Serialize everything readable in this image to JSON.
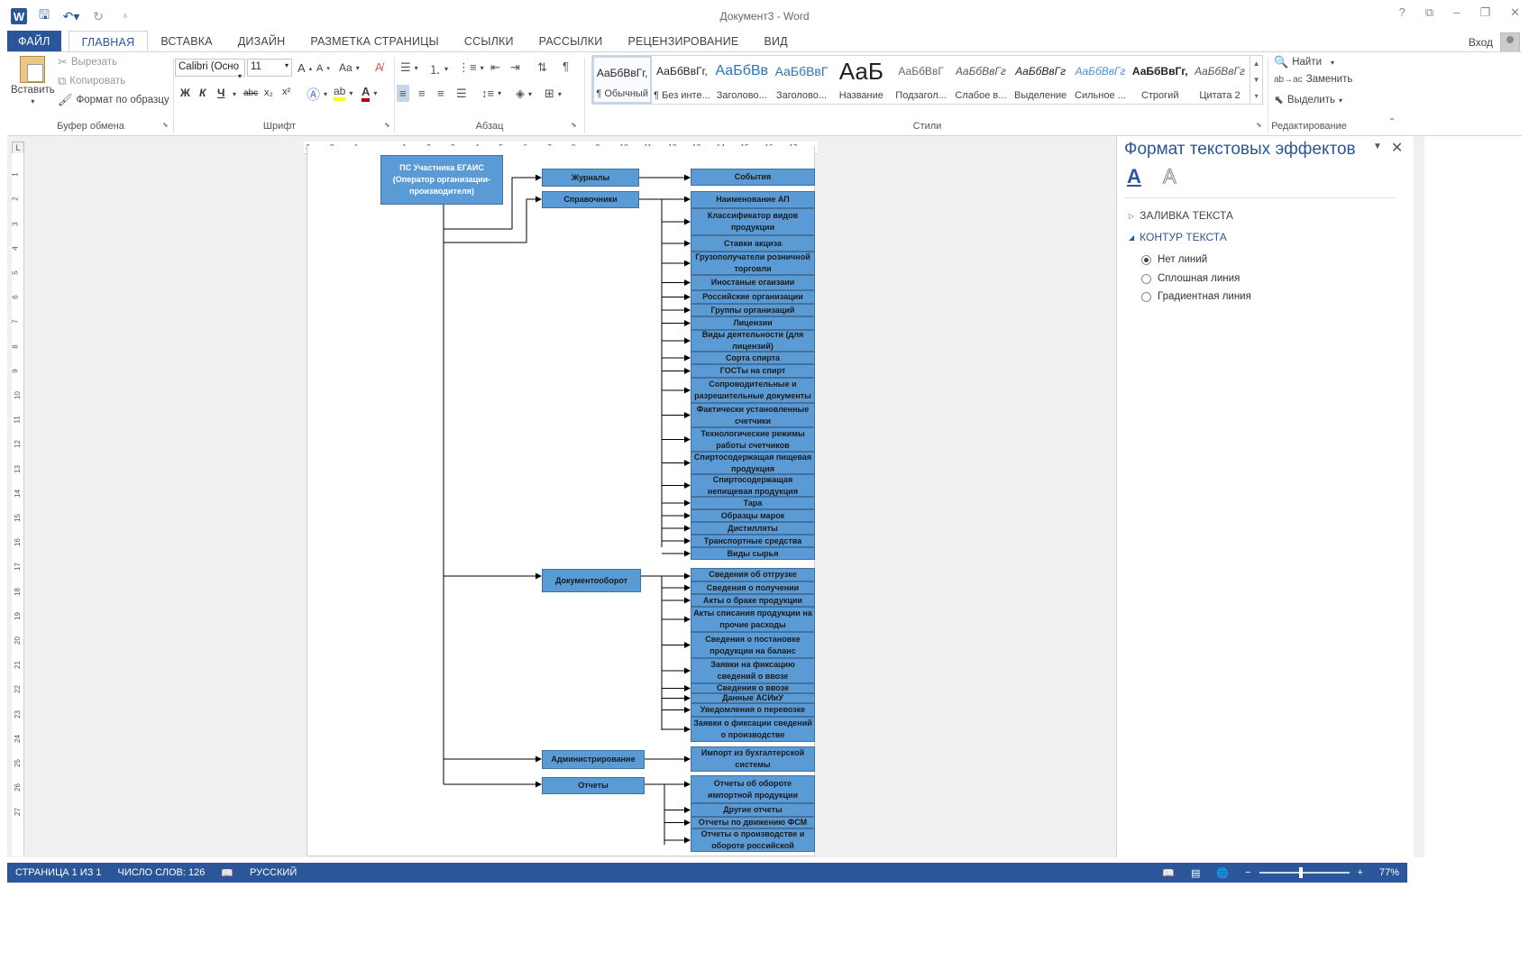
{
  "window": {
    "title": "Документ3 - Word",
    "signin": "Вход",
    "help": "?",
    "minimize": "–",
    "restore": "❐",
    "close": "✕"
  },
  "tabs": [
    "ФАЙЛ",
    "ГЛАВНАЯ",
    "ВСТАВКА",
    "ДИЗАЙН",
    "РАЗМЕТКА СТРАНИЦЫ",
    "ССЫЛКИ",
    "РАССЫЛКИ",
    "РЕЦЕНЗИРОВАНИЕ",
    "ВИД"
  ],
  "clipboard": {
    "paste": "Вставить",
    "cut": "Вырезать",
    "copy": "Копировать",
    "format_painter": "Формат по образцу",
    "label": "Буфер обмена"
  },
  "font": {
    "name": "Calibri (Осно",
    "size": "11",
    "label": "Шрифт",
    "bold": "Ж",
    "italic": "К",
    "underline": "Ч",
    "strike": "abc",
    "sub": "x₂",
    "sup": "x²",
    "grow": "A",
    "shrink": "A",
    "case": "Aa"
  },
  "paragraph": {
    "label": "Абзац"
  },
  "styles": {
    "label": "Стили",
    "items": [
      {
        "preview": "АаБбВвГг,",
        "name": "¶ Обычный"
      },
      {
        "preview": "АаБбВвГг,",
        "name": "¶ Без инте..."
      },
      {
        "preview": "АаБбВв",
        "name": "Заголово..."
      },
      {
        "preview": "АаБбВвГ",
        "name": "Заголово..."
      },
      {
        "preview": "АаБ",
        "name": "Название"
      },
      {
        "preview": "АаБбВвГ",
        "name": "Подзагол..."
      },
      {
        "preview": "АаБбВвГг",
        "name": "Слабое в..."
      },
      {
        "preview": "АаБбВвГг",
        "name": "Выделение"
      },
      {
        "preview": "АаБбВвГг",
        "name": "Сильное ..."
      },
      {
        "preview": "АаБбВвГг,",
        "name": "Строгий"
      },
      {
        "preview": "АаБбВвГг",
        "name": "Цитата 2"
      }
    ]
  },
  "editing": {
    "find": "Найти",
    "replace": "Заменить",
    "select": "Выделить",
    "label": "Редактирование"
  },
  "diagram": {
    "root": "ПС Участника ЕГАИС (Оператор организации-производителя)",
    "journals": "Журналы",
    "events": "События",
    "refs": "Справочники",
    "ref_items": [
      "Наименование АП",
      "Классификатор видов продукции",
      "Ставки акциза",
      "Грузополучатели розничной торговли",
      "Иностаные огаизаии",
      "Российские организации",
      "Группы организаций",
      "Лицензии",
      "Виды деятельности (для лицензий)",
      "Сорта спирта",
      "ГОСТы на спирт",
      "Сопроводительные и разрешительные документы",
      "Фактически установленные счетчики",
      "Технологические режимы работы счетчиков",
      "Спиртосодержащая пищевая продукция",
      "Спиртосодержащая непищевая продукция",
      "Тара",
      "Образцы марок",
      "Дистилляты",
      "Транспортные средства",
      "Виды сырья"
    ],
    "docs": "Документооборот",
    "doc_items": [
      "Сведения об отгрузке",
      "Сведения о получении",
      "Акты о браке продукции",
      "Акты списания продукции на прочие расходы",
      "Сведения о постановке продукции на баланс",
      "Заявки на фиксацию сведений о ввозе",
      "Сведения о ввозе",
      "Данные АСИиУ",
      "Уведомления о перевозке",
      "Заявки о фиксации сведений о производстве"
    ],
    "admin": "Администрирование",
    "admin_item": "Импорт из бухгалтерской системы",
    "reports": "Отчеты",
    "report_items": [
      "Отчеты об обороте импортной продукции",
      "Другие отчеты",
      "Отчеты по движению ФСМ",
      "Отчеты о производстве и обороте российской"
    ]
  },
  "pane": {
    "title": "Формат текстовых эффектов",
    "fill": "ЗАЛИВКА ТЕКСТА",
    "outline": "КОНТУР ТЕКСТА",
    "options": [
      "Нет линий",
      "Сплошная линия",
      "Градиентная линия"
    ]
  },
  "status": {
    "page": "СТРАНИЦА 1 ИЗ 1",
    "words": "ЧИСЛО СЛОВ: 126",
    "lang": "РУССКИЙ",
    "zoom": "77%"
  },
  "colors": {
    "accent": "#2b579a",
    "box": "#5b9bd5"
  }
}
